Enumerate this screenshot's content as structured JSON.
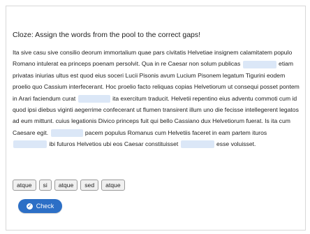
{
  "exercise": {
    "title": "Cloze: Assign the words from the pool to the correct gaps!",
    "segments": [
      "Ita sive casu sive consilio deorum immortalium quae pars civitatis Helvetiae insignem calamitatem populo Romano intulerat ea princeps poenam persolvit. Qua in re Caesar non solum publicas",
      "etiam privatas iniurias ultus est quod eius soceri Lucii Pisonis avum Lucium Pisonem legatum Tigurini eodem proelio quo Cassium interfecerant. Hoc proelio facto reliquas copias Helvetiorum ut consequi posset pontem in Arari faciendum curat",
      "ita exercitum traducit. Helvetii repentino eius adventu commoti cum id quod ipsi diebus viginti aegerrime confecerant ut flumen transirent illum uno die fecisse intellegerent legatos ad eum mittunt. cuius legationis Divico princeps fuit qui bello Cassiano dux Helvetiorum fuerat. Is ita cum Caesare egit.",
      "pacem populus Romanus cum Helvetiis faceret in eam partem ituros",
      "ibi futuros Helvetios ubi eos Caesar constituisset",
      "esse voluisset."
    ]
  },
  "pool": [
    "atque",
    "si",
    "atque",
    "sed",
    "atque"
  ],
  "check_button": {
    "label": "Check",
    "icon": "check-circle-icon"
  },
  "colors": {
    "gap": "#dbe7f7",
    "button": "#2c6fc6"
  }
}
